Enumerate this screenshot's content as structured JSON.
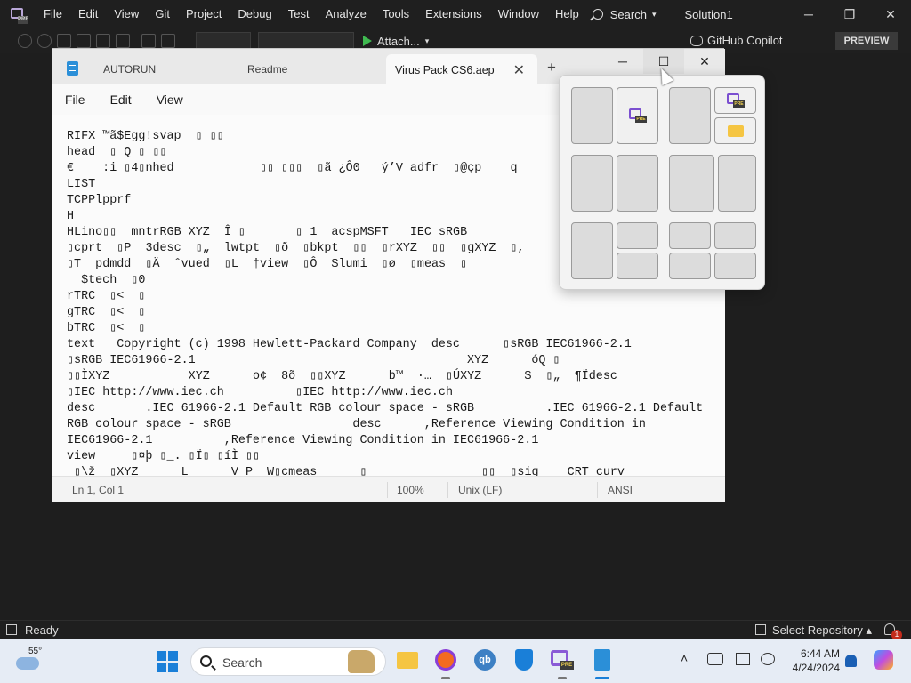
{
  "vs": {
    "menu": [
      "File",
      "Edit",
      "View",
      "Git",
      "Project",
      "Debug",
      "Test",
      "Analyze",
      "Tools",
      "Extensions",
      "Window",
      "Help"
    ],
    "search_label": "Search",
    "solution": "Solution1",
    "attach_label": "Attach...",
    "copilot_label": "GitHub Copilot",
    "preview_label": "PREVIEW",
    "status_ready": "Ready",
    "status_repo": "Select Repository",
    "notification_count": "1"
  },
  "notepad": {
    "tabs": [
      "AUTORUN",
      "Readme",
      "Virus Pack CS6.aep"
    ],
    "menu": [
      "File",
      "Edit",
      "View"
    ],
    "lines": [
      "RIFX ™ã$Egg!svap  ▯ ▯▯",
      "head  ▯ Q ▯ ▯▯",
      "€    :i ▯4▯nhed            ▯▯ ▯▯▯  ▯ã ¿Ô0   ý’V adfr  ▯@çp    q",
      "LIST",
      "TCPPlpprf",
      "H",
      "HLino▯▯  mntrRGB XYZ  Î ▯       ▯ 1  acspMSFT   IEC sRGB",
      "▯cprt  ▯P  3desc  ▯„  lwtpt  ▯ð  ▯bkpt  ▯▯  ▯rXYZ  ▯▯  ▯gXYZ  ▯,",
      "▯T  pdmdd  ▯Ä  ˆvued  ▯L  †view  ▯Ô  $lumi  ▯ø  ▯meas  ▯",
      "  $tech  ▯0",
      "rTRC  ▯<  ▯",
      "gTRC  ▯<  ▯",
      "bTRC  ▯<  ▯",
      "text   Copyright (c) 1998 Hewlett-Packard Company  desc      ▯sRGB IEC61966-2.1",
      "▯sRGB IEC61966-2.1                                      XYZ      óQ ▯",
      "▯▯ÌXYZ           XYZ      o¢  8õ  ▯▯XYZ      b™  ·…  ▯ÚXYZ      $  ▯„  ¶Ïdesc",
      "▯IEC http://www.iec.ch          ▯IEC http://www.iec.ch",
      "desc       .IEC 61966-2.1 Default RGB colour space - sRGB          .IEC 61966-2.1 Default",
      "RGB colour space - sRGB                 desc      ,Reference Viewing Condition in",
      "IEC61966-2.1          ,Reference Viewing Condition in IEC61966-2.1",
      "view     ▯¤þ ▯_. ▯Ï▯ ▯íÌ ▯▯",
      " ▯\\ž  ▯XYZ      L      V P  W▯cmeas      ▯                ▯▯  ▯sig    CRT curv"
    ],
    "status_pos": "Ln 1, Col 1",
    "status_zoom": "100%",
    "status_eol": "Unix (LF)",
    "status_enc": "ANSI"
  },
  "taskbar": {
    "temperature": "55°",
    "search_label": "Search",
    "time": "6:44 AM",
    "date": "4/24/2024"
  }
}
